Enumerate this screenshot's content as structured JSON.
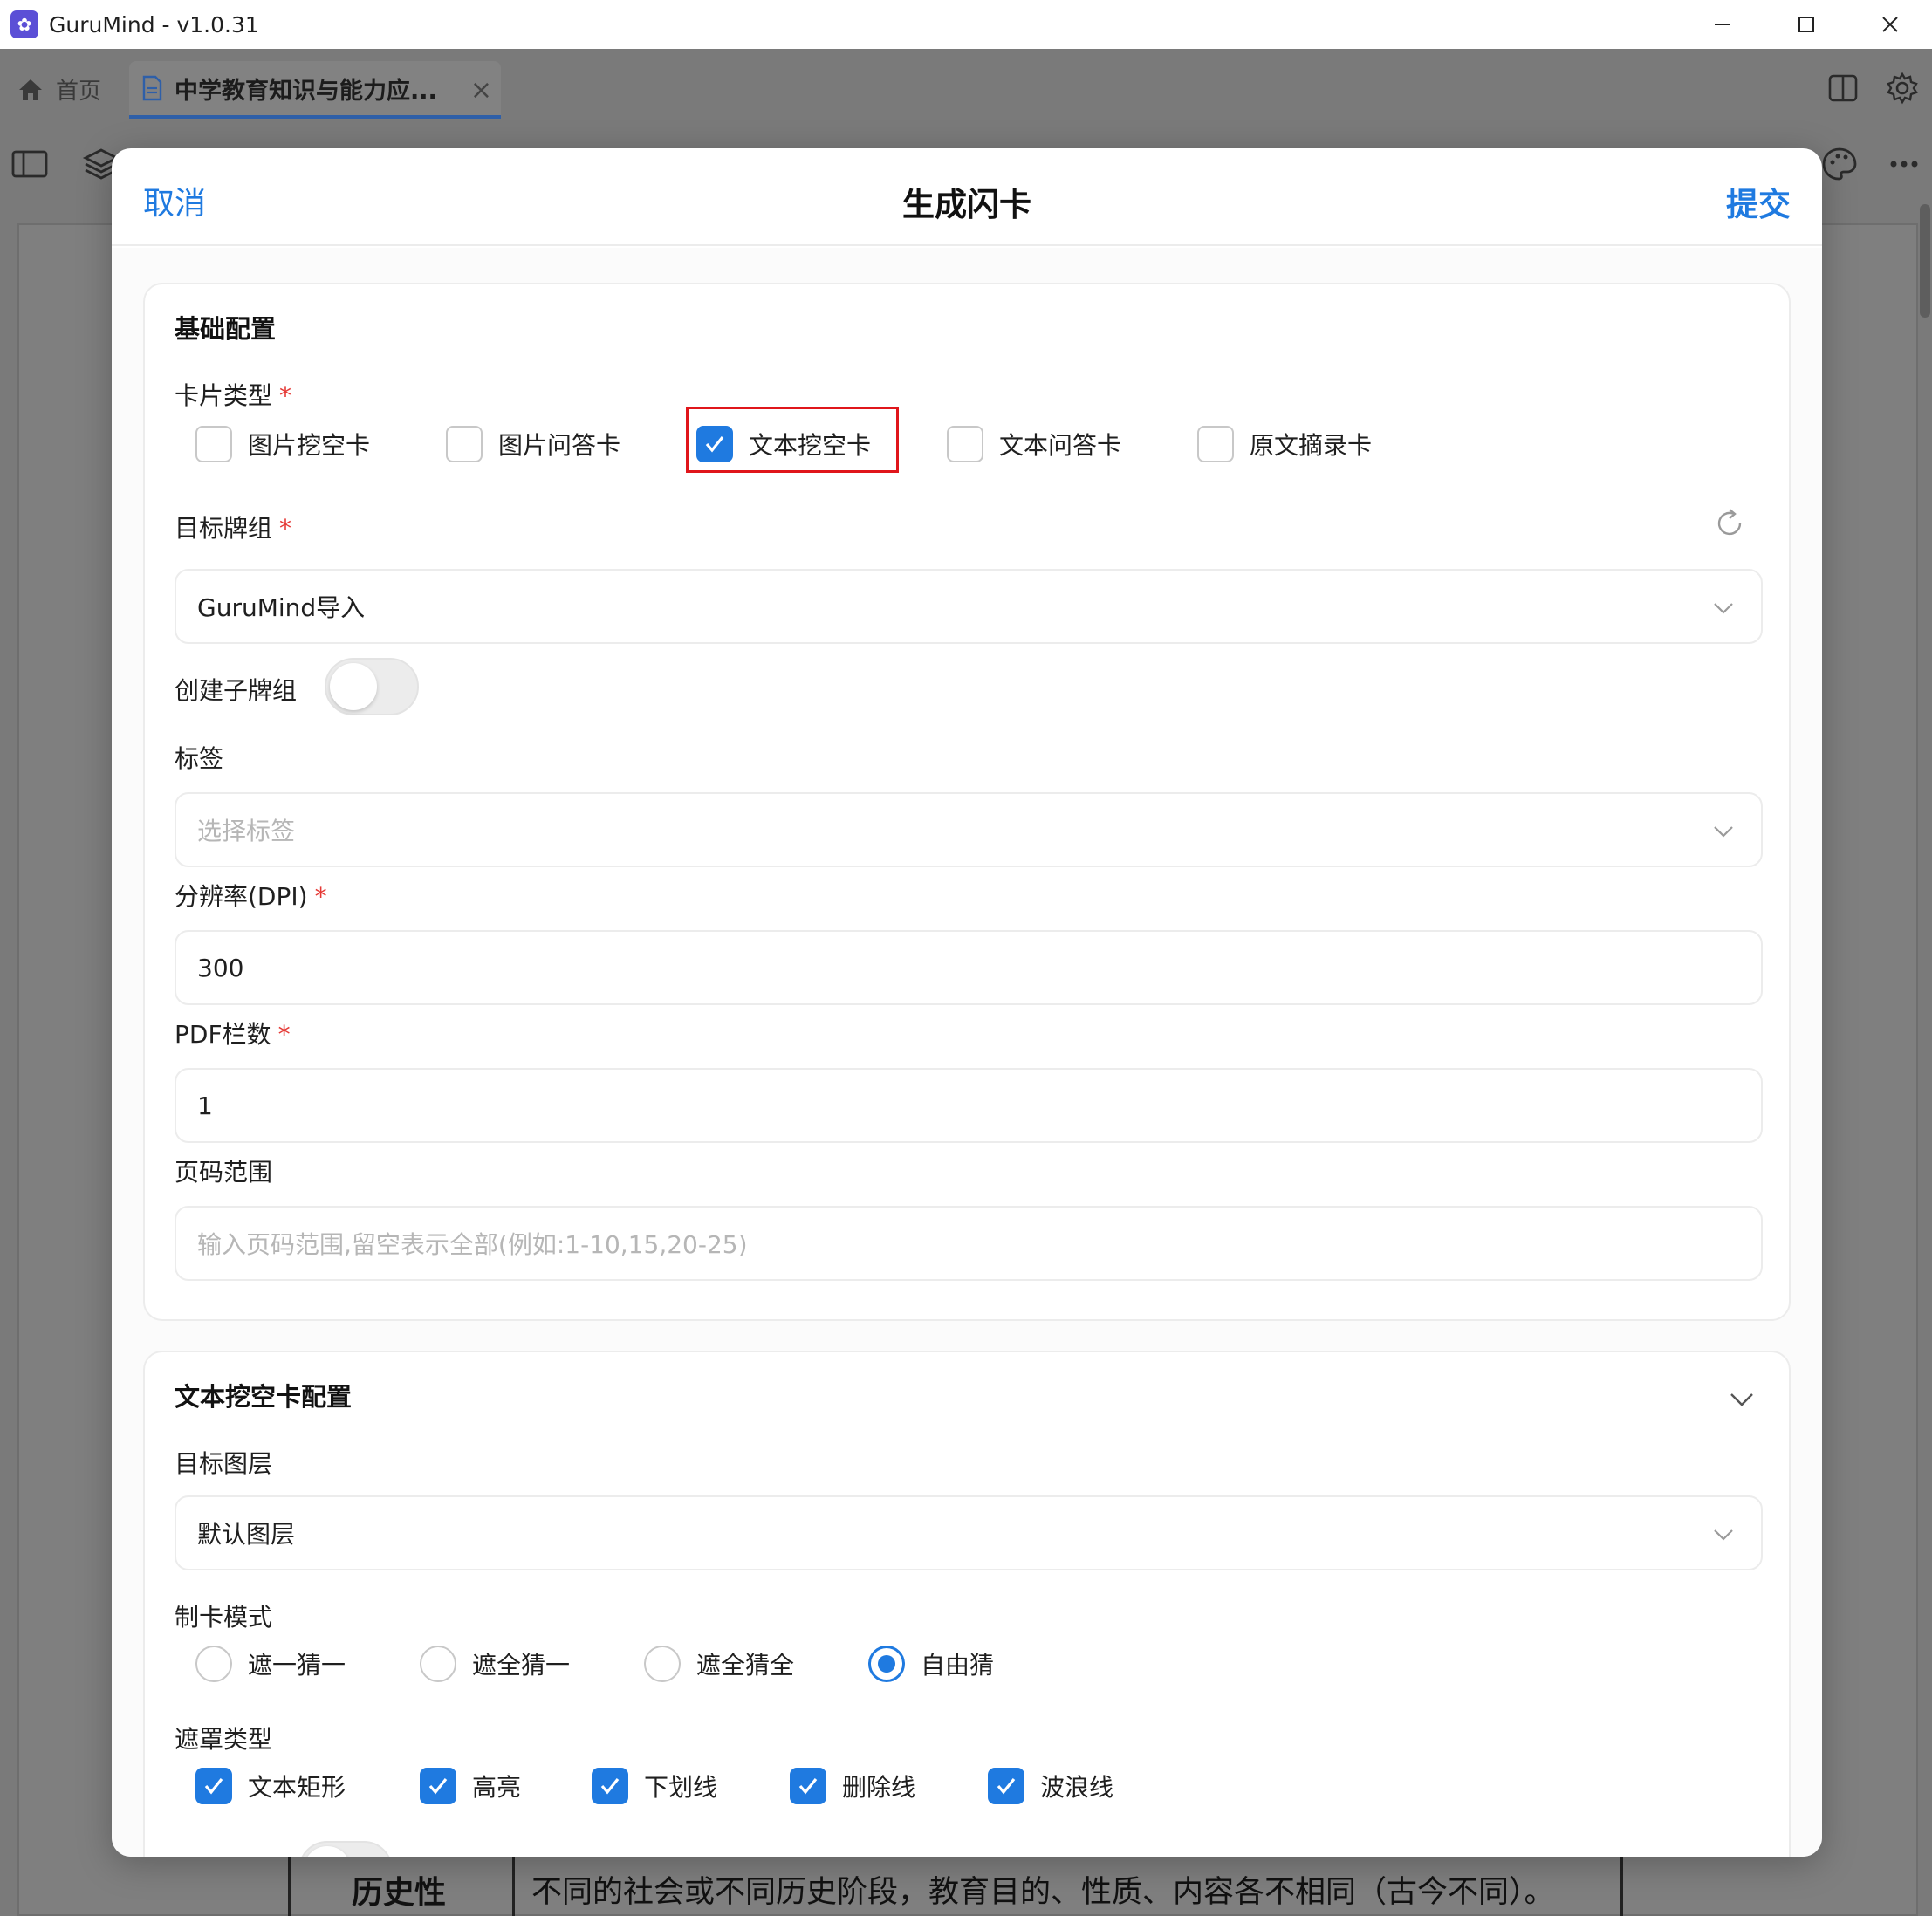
{
  "window": {
    "title": "GuruMind - v1.0.31"
  },
  "tabs": {
    "home_label": "首页",
    "doc_label": "中学教育知识与能力应...",
    "close_glyph": "×"
  },
  "modal": {
    "cancel_label": "取消",
    "title": "生成闪卡",
    "submit_label": "提交",
    "basic": {
      "title": "基础配置",
      "card_type_label": "卡片类型",
      "required_mark": "*",
      "card_types": [
        {
          "label": "图片挖空卡",
          "checked": false
        },
        {
          "label": "图片问答卡",
          "checked": false
        },
        {
          "label": "文本挖空卡",
          "checked": true
        },
        {
          "label": "文本问答卡",
          "checked": false
        },
        {
          "label": "原文摘录卡",
          "checked": false
        }
      ],
      "deck_label": "目标牌组",
      "deck_value": "GuruMind导入",
      "subdeck_label": "创建子牌组",
      "subdeck_on": false,
      "tags_label": "标签",
      "tags_placeholder": "选择标签",
      "dpi_label": "分辨率(DPI)",
      "dpi_value": "300",
      "columns_label": "PDF栏数",
      "columns_value": "1",
      "pages_label": "页码范围",
      "pages_placeholder": "输入页码范围,留空表示全部(例如:1-10,15,20-25)"
    },
    "cloze": {
      "title": "文本挖空卡配置",
      "layer_label": "目标图层",
      "layer_value": "默认图层",
      "mode_label": "制卡模式",
      "modes": [
        {
          "label": "遮一猜一",
          "selected": false
        },
        {
          "label": "遮全猜一",
          "selected": false
        },
        {
          "label": "遮全猜全",
          "selected": false
        },
        {
          "label": "自由猜",
          "selected": true
        }
      ],
      "mask_label": "遮罩类型",
      "masks": [
        {
          "label": "文本矩形",
          "checked": true
        },
        {
          "label": "高亮",
          "checked": true
        },
        {
          "label": "下划线",
          "checked": true
        },
        {
          "label": "删除线",
          "checked": true
        },
        {
          "label": "波浪线",
          "checked": true
        }
      ]
    }
  },
  "background": {
    "cell_a": "历史性",
    "cell_b": "不同的社会或不同历史阶段，教育目的、性质、内容各不相同（古今不同）。"
  },
  "colors": {
    "accent": "#1f7ae0",
    "required": "#e53935",
    "highlight": "#e0161b"
  }
}
